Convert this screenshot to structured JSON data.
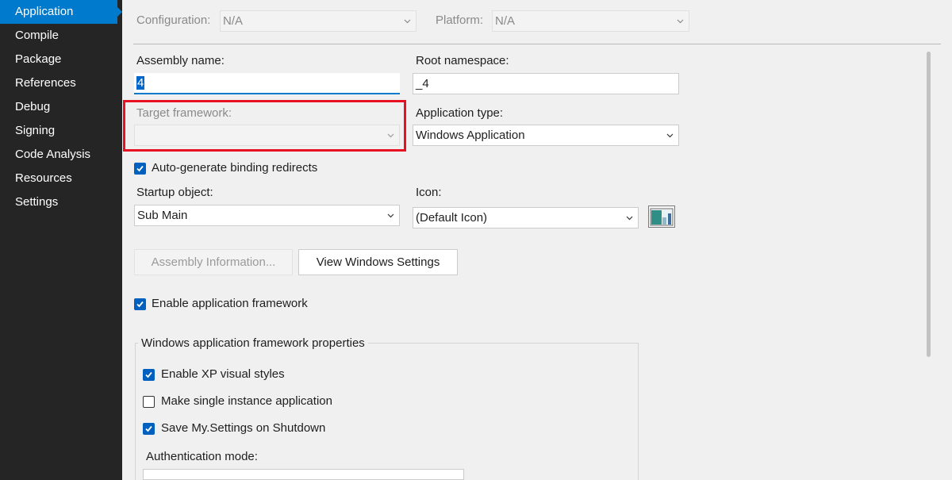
{
  "sidebar": {
    "items": [
      {
        "label": "Application",
        "active": true
      },
      {
        "label": "Compile"
      },
      {
        "label": "Package"
      },
      {
        "label": "References"
      },
      {
        "label": "Debug"
      },
      {
        "label": "Signing"
      },
      {
        "label": "Code Analysis"
      },
      {
        "label": "Resources"
      },
      {
        "label": "Settings"
      }
    ]
  },
  "toolbar": {
    "configuration_label": "Configuration:",
    "configuration_value": "N/A",
    "platform_label": "Platform:",
    "platform_value": "N/A"
  },
  "form": {
    "assembly_name_label": "Assembly name:",
    "assembly_name_value": "4",
    "root_namespace_label": "Root namespace:",
    "root_namespace_value": "_4",
    "target_framework_label": "Target framework:",
    "target_framework_value": "",
    "application_type_label": "Application type:",
    "application_type_value": "Windows Application",
    "auto_binding_label": "Auto-generate binding redirects",
    "startup_object_label": "Startup object:",
    "startup_object_value": "Sub Main",
    "icon_label": "Icon:",
    "icon_value": "(Default Icon)",
    "assembly_info_button": "Assembly Information...",
    "view_windows_settings_button": "View Windows Settings",
    "enable_app_framework_label": "Enable application framework"
  },
  "framework_group": {
    "title": "Windows application framework properties",
    "xp_styles_label": "Enable XP visual styles",
    "single_instance_label": "Make single instance application",
    "save_settings_label": "Save My.Settings on Shutdown",
    "auth_mode_label": "Authentication mode:"
  },
  "checkbox_states": {
    "auto_binding": true,
    "enable_app_framework": true,
    "xp_styles": true,
    "single_instance": false,
    "save_settings": true
  },
  "colors": {
    "sidebar_bg": "#252526",
    "accent": "#007acc",
    "highlight_border": "#e81123",
    "page_bg": "#f0f0f0"
  }
}
